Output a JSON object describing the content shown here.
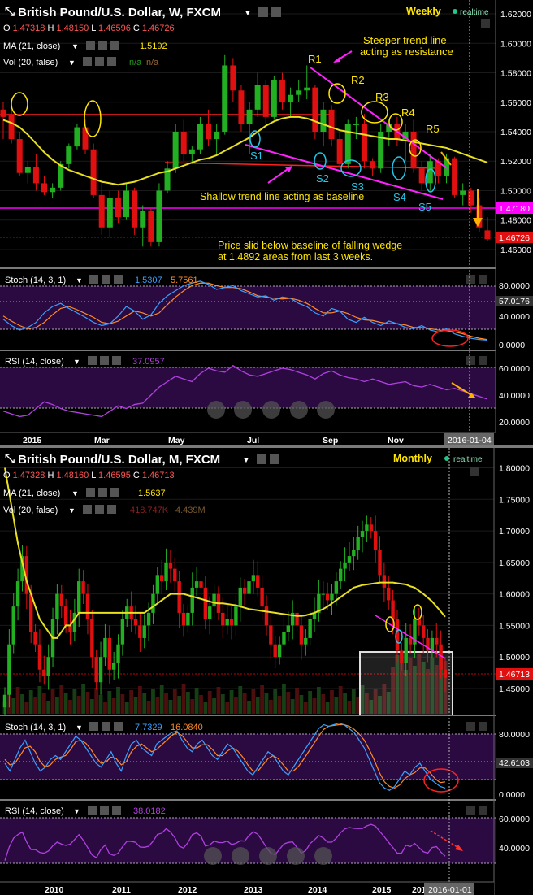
{
  "charts": [
    {
      "symbol": "British Pound/U.S. Dollar, W, FXCM",
      "period_badge": "Weekly",
      "realtime": "realtime",
      "ohlc": {
        "O": "1.47318",
        "H": "1.48150",
        "L": "1.46596",
        "C": "1.46726"
      },
      "ma_label": "MA (21, close)",
      "ma_value": "1.5192",
      "vol_label": "Vol (20, false)",
      "vol_values": [
        "n/a",
        "n/a"
      ],
      "price_axis": [
        "1.62000",
        "1.60000",
        "1.58000",
        "1.56000",
        "1.54000",
        "1.52000",
        "1.50000",
        "1.48000",
        "1.46000"
      ],
      "price_tags": {
        "baseline": "1.47180",
        "last": "1.46726"
      },
      "stoch": {
        "label": "Stoch (14, 3, 1)",
        "k": "1.5307",
        "d": "5.7561",
        "axis": [
          "80.0000",
          "40.0000",
          "0.0000"
        ],
        "tag": "57.0176"
      },
      "rsi": {
        "label": "RSI (14, close)",
        "value": "37.0957",
        "axis": [
          "60.0000",
          "40.0000",
          "20.0000"
        ]
      },
      "x_labels": [
        "2015",
        "Mar",
        "May",
        "Jul",
        "Sep",
        "Nov"
      ],
      "date_tag": "2016-01-04",
      "annotations": {
        "steeper": [
          "Steeper trend line",
          "acting as resistance"
        ],
        "shallow": "Shallow trend line acting as baseline",
        "slid": [
          "Price slid below baseline of falling wedge",
          "at 1.4892 areas from last 3 weeks."
        ],
        "resistances": [
          "R1",
          "R2",
          "R3",
          "R4",
          "R5"
        ],
        "supports": [
          "S1",
          "S2",
          "S3",
          "S4",
          "S5"
        ]
      }
    },
    {
      "symbol": "British Pound/U.S. Dollar, M, FXCM",
      "period_badge": "Monthly",
      "realtime": "realtime",
      "ohlc": {
        "O": "1.47328",
        "H": "1.48160",
        "L": "1.46595",
        "C": "1.46713"
      },
      "ma_label": "MA (21, close)",
      "ma_value": "1.5637",
      "vol_label": "Vol (20, false)",
      "vol_values": [
        "418.747K",
        "4.439M"
      ],
      "price_axis": [
        "1.80000",
        "1.75000",
        "1.70000",
        "1.65000",
        "1.60000",
        "1.55000",
        "1.50000",
        "1.45000"
      ],
      "price_tags": {
        "last": "1.46713"
      },
      "stoch": {
        "label": "Stoch (14, 3, 1)",
        "k": "7.7329",
        "d": "16.0840",
        "axis": [
          "80.0000",
          "0.0000"
        ],
        "tag": "42.6103"
      },
      "rsi": {
        "label": "RSI (14, close)",
        "value": "38.0182",
        "axis": [
          "60.0000",
          "40.0000"
        ]
      },
      "x_labels": [
        "2010",
        "2011",
        "2012",
        "2013",
        "2014",
        "2015",
        "2015"
      ],
      "date_tag": "2016-01-01"
    }
  ],
  "colors": {
    "up": "#22b022",
    "down": "#e01010",
    "ma": "#e8e020",
    "stoch_k": "#3aa0ff",
    "stoch_d": "#ff8a2a",
    "rsi": "#b040e0",
    "panel": "#2a0a40",
    "magenta": "#ff22ff",
    "cyan": "#22c8e8",
    "yellow": "#ffe600",
    "baseline": "#ff00ff"
  },
  "chart_data": [
    {
      "type": "candlestick",
      "title": "British Pound/U.S. Dollar, W, FXCM",
      "ylim": [
        1.455,
        1.625
      ],
      "x_labels": [
        "2015",
        "Mar",
        "May",
        "Jul",
        "Sep",
        "Nov"
      ],
      "candles": [
        [
          1.555,
          1.56,
          1.535,
          1.55
        ],
        [
          1.552,
          1.555,
          1.532,
          1.535
        ],
        [
          1.535,
          1.54,
          1.51,
          1.512
        ],
        [
          1.512,
          1.52,
          1.505,
          1.516
        ],
        [
          1.516,
          1.525,
          1.5,
          1.505
        ],
        [
          1.505,
          1.51,
          1.497,
          1.499
        ],
        [
          1.499,
          1.505,
          1.495,
          1.502
        ],
        [
          1.502,
          1.52,
          1.5,
          1.518
        ],
        [
          1.518,
          1.532,
          1.515,
          1.53
        ],
        [
          1.53,
          1.545,
          1.528,
          1.543
        ],
        [
          1.543,
          1.548,
          1.525,
          1.528
        ],
        [
          1.528,
          1.532,
          1.495,
          1.497
        ],
        [
          1.497,
          1.505,
          1.47,
          1.475
        ],
        [
          1.475,
          1.5,
          1.468,
          1.495
        ],
        [
          1.495,
          1.5,
          1.478,
          1.482
        ],
        [
          1.482,
          1.505,
          1.48,
          1.5
        ],
        [
          1.5,
          1.502,
          1.47,
          1.475
        ],
        [
          1.475,
          1.49,
          1.462,
          1.486
        ],
        [
          1.486,
          1.488,
          1.462,
          1.465
        ],
        [
          1.465,
          1.505,
          1.462,
          1.5
        ],
        [
          1.5,
          1.52,
          1.498,
          1.515
        ],
        [
          1.515,
          1.545,
          1.512,
          1.54
        ],
        [
          1.54,
          1.548,
          1.52,
          1.525
        ],
        [
          1.525,
          1.53,
          1.518,
          1.528
        ],
        [
          1.528,
          1.55,
          1.525,
          1.545
        ],
        [
          1.545,
          1.555,
          1.53,
          1.535
        ],
        [
          1.535,
          1.545,
          1.525,
          1.54
        ],
        [
          1.54,
          1.592,
          1.538,
          1.585
        ],
        [
          1.585,
          1.59,
          1.56,
          1.568
        ],
        [
          1.568,
          1.572,
          1.54,
          1.545
        ],
        [
          1.545,
          1.56,
          1.525,
          1.555
        ],
        [
          1.555,
          1.58,
          1.55,
          1.572
        ],
        [
          1.572,
          1.575,
          1.545,
          1.55
        ],
        [
          1.55,
          1.578,
          1.548,
          1.575
        ],
        [
          1.575,
          1.58,
          1.555,
          1.56
        ],
        [
          1.56,
          1.57,
          1.55,
          1.565
        ],
        [
          1.565,
          1.575,
          1.56,
          1.568
        ],
        [
          1.568,
          1.585,
          1.562,
          1.57
        ],
        [
          1.57,
          1.572,
          1.535,
          1.54
        ],
        [
          1.54,
          1.56,
          1.53,
          1.555
        ],
        [
          1.555,
          1.558,
          1.53,
          1.535
        ],
        [
          1.535,
          1.54,
          1.515,
          1.518
        ],
        [
          1.518,
          1.548,
          1.515,
          1.545
        ],
        [
          1.545,
          1.55,
          1.535,
          1.545
        ],
        [
          1.545,
          1.552,
          1.515,
          1.52
        ],
        [
          1.52,
          1.522,
          1.51,
          1.515
        ],
        [
          1.515,
          1.545,
          1.512,
          1.54
        ],
        [
          1.54,
          1.548,
          1.53,
          1.545
        ],
        [
          1.545,
          1.55,
          1.53,
          1.535
        ],
        [
          1.535,
          1.545,
          1.52,
          1.54
        ],
        [
          1.54,
          1.548,
          1.512,
          1.515
        ],
        [
          1.515,
          1.52,
          1.5,
          1.505
        ],
        [
          1.505,
          1.525,
          1.5,
          1.52
        ],
        [
          1.52,
          1.522,
          1.505,
          1.51
        ],
        [
          1.51,
          1.525,
          1.505,
          1.522
        ],
        [
          1.522,
          1.523,
          1.495,
          1.497
        ],
        [
          1.497,
          1.505,
          1.49,
          1.5
        ],
        [
          1.5,
          1.502,
          1.485,
          1.49
        ],
        [
          1.49,
          1.495,
          1.472,
          1.475
        ],
        [
          1.473,
          1.482,
          1.466,
          1.467
        ]
      ],
      "ma": [
        1.548,
        1.546,
        1.543,
        1.538,
        1.532,
        1.526,
        1.521,
        1.517,
        1.514,
        1.512,
        1.51,
        1.508,
        1.506,
        1.505,
        1.504,
        1.505,
        1.506,
        1.508,
        1.51,
        1.512,
        1.513,
        1.515,
        1.517,
        1.519,
        1.521,
        1.522,
        1.524,
        1.527,
        1.53,
        1.533,
        1.536,
        1.54,
        1.544,
        1.547,
        1.549,
        1.55,
        1.55,
        1.549,
        1.547,
        1.545,
        1.543,
        1.541,
        1.54,
        1.539,
        1.538,
        1.537,
        1.536,
        1.535,
        1.535,
        1.534,
        1.533,
        1.532,
        1.531,
        1.53,
        1.529,
        1.527,
        1.525,
        1.523,
        1.521,
        1.519
      ],
      "stoch_k": [
        35,
        25,
        18,
        22,
        30,
        45,
        55,
        60,
        52,
        45,
        38,
        30,
        25,
        28,
        40,
        55,
        48,
        35,
        42,
        60,
        72,
        80,
        88,
        92,
        95,
        90,
        82,
        85,
        88,
        80,
        75,
        70,
        72,
        65,
        70,
        68,
        60,
        55,
        45,
        40,
        52,
        48,
        35,
        30,
        38,
        30,
        25,
        32,
        28,
        22,
        20,
        25,
        18,
        15,
        20,
        12,
        8,
        5,
        3,
        2
      ],
      "stoch_d": [
        40,
        32,
        25,
        20,
        22,
        30,
        42,
        52,
        55,
        50,
        44,
        38,
        30,
        28,
        32,
        40,
        48,
        45,
        40,
        45,
        58,
        70,
        80,
        88,
        92,
        92,
        88,
        85,
        85,
        83,
        78,
        72,
        70,
        68,
        67,
        68,
        65,
        60,
        52,
        45,
        45,
        48,
        44,
        38,
        34,
        33,
        30,
        28,
        28,
        26,
        22,
        22,
        20,
        18,
        17,
        15,
        12,
        8,
        5,
        3
      ],
      "rsi": [
        28,
        26,
        24,
        25,
        30,
        35,
        33,
        30,
        28,
        27,
        26,
        25,
        24,
        28,
        32,
        30,
        33,
        34,
        40,
        46,
        50,
        54,
        52,
        50,
        56,
        60,
        58,
        57,
        62,
        58,
        55,
        54,
        56,
        58,
        60,
        59,
        57,
        55,
        52,
        56,
        58,
        55,
        53,
        52,
        50,
        52,
        50,
        48,
        49,
        50,
        47,
        46,
        48,
        46,
        44,
        45,
        43,
        41,
        39,
        37
      ]
    },
    {
      "type": "candlestick",
      "title": "British Pound/U.S. Dollar, M, FXCM",
      "ylim": [
        1.41,
        1.82
      ],
      "x_labels": [
        "2010",
        "2011",
        "2012",
        "2013",
        "2014",
        "2015",
        "2015"
      ],
      "closes": [
        1.44,
        1.52,
        1.58,
        1.62,
        1.66,
        1.6,
        1.54,
        1.52,
        1.48,
        1.47,
        1.5,
        1.56,
        1.6,
        1.58,
        1.55,
        1.54,
        1.57,
        1.62,
        1.6,
        1.56,
        1.5,
        1.46,
        1.5,
        1.53,
        1.48,
        1.49,
        1.52,
        1.56,
        1.58,
        1.56,
        1.55,
        1.53,
        1.55,
        1.57,
        1.6,
        1.63,
        1.62,
        1.65,
        1.64,
        1.62,
        1.57,
        1.55,
        1.57,
        1.61,
        1.62,
        1.61,
        1.56,
        1.58,
        1.6,
        1.57,
        1.55,
        1.56,
        1.55,
        1.58,
        1.61,
        1.6,
        1.62,
        1.63,
        1.61,
        1.58,
        1.55,
        1.52,
        1.5,
        1.52,
        1.54,
        1.55,
        1.57,
        1.55,
        1.52,
        1.53,
        1.56,
        1.57,
        1.6,
        1.6,
        1.59,
        1.6,
        1.62,
        1.64,
        1.65,
        1.66,
        1.67,
        1.69,
        1.7,
        1.71,
        1.7,
        1.67,
        1.63,
        1.61,
        1.59,
        1.56,
        1.51,
        1.49,
        1.53,
        1.52,
        1.56,
        1.55,
        1.53,
        1.51,
        1.53,
        1.52,
        1.48,
        1.467
      ],
      "ma": [
        1.8,
        1.76,
        1.72,
        1.68,
        1.65,
        1.62,
        1.6,
        1.58,
        1.56,
        1.55,
        1.54,
        1.53,
        1.53,
        1.54,
        1.55,
        1.55,
        1.56,
        1.57,
        1.57,
        1.57,
        1.57,
        1.57,
        1.57,
        1.57,
        1.57,
        1.57,
        1.57,
        1.57,
        1.57,
        1.57,
        1.57,
        1.57,
        1.57,
        1.575,
        1.58,
        1.585,
        1.59,
        1.595,
        1.6,
        1.6,
        1.6,
        1.6,
        1.598,
        1.596,
        1.594,
        1.592,
        1.59,
        1.588,
        1.586,
        1.585,
        1.585,
        1.584,
        1.583,
        1.582,
        1.58,
        1.578,
        1.576,
        1.575,
        1.574,
        1.573,
        1.572,
        1.571,
        1.57,
        1.569,
        1.568,
        1.567,
        1.566,
        1.565,
        1.565,
        1.566,
        1.568,
        1.57,
        1.573,
        1.576,
        1.58,
        1.585,
        1.59,
        1.595,
        1.6,
        1.605,
        1.61,
        1.612,
        1.614,
        1.615,
        1.616,
        1.617,
        1.618,
        1.618,
        1.618,
        1.618,
        1.617,
        1.616,
        1.615,
        1.612,
        1.61,
        1.605,
        1.6,
        1.594,
        1.588,
        1.58,
        1.572,
        1.5637
      ],
      "stoch_k": [
        40,
        30,
        45,
        60,
        70,
        55,
        40,
        30,
        35,
        45,
        50,
        45,
        55,
        65,
        75,
        70,
        60,
        50,
        40,
        35,
        45,
        55,
        40,
        30,
        50,
        65,
        70,
        60,
        55,
        50,
        65,
        70,
        75,
        80,
        82,
        70,
        60,
        55,
        65,
        70,
        60,
        50,
        45,
        55,
        65,
        60,
        50,
        40,
        30,
        25,
        35,
        45,
        55,
        50,
        40,
        30,
        25,
        35,
        45,
        55,
        65,
        75,
        85,
        90,
        88,
        90,
        92,
        90,
        85,
        80,
        70,
        60,
        45,
        30,
        15,
        8,
        5,
        10,
        20,
        30,
        25,
        35,
        40,
        30,
        20,
        15,
        10,
        8
      ],
      "stoch_d": [
        45,
        38,
        40,
        50,
        60,
        62,
        55,
        42,
        35,
        38,
        45,
        48,
        50,
        58,
        68,
        70,
        66,
        58,
        48,
        40,
        42,
        48,
        46,
        38,
        42,
        55,
        62,
        65,
        60,
        55,
        58,
        64,
        70,
        76,
        80,
        76,
        68,
        60,
        60,
        64,
        64,
        58,
        50,
        50,
        56,
        60,
        56,
        48,
        38,
        30,
        30,
        38,
        46,
        50,
        46,
        38,
        30,
        30,
        36,
        45,
        55,
        65,
        75,
        84,
        88,
        89,
        90,
        90,
        88,
        84,
        78,
        70,
        58,
        44,
        28,
        16,
        10,
        8,
        12,
        20,
        25,
        28,
        34,
        34,
        28,
        20,
        15,
        16
      ]
    }
  ]
}
